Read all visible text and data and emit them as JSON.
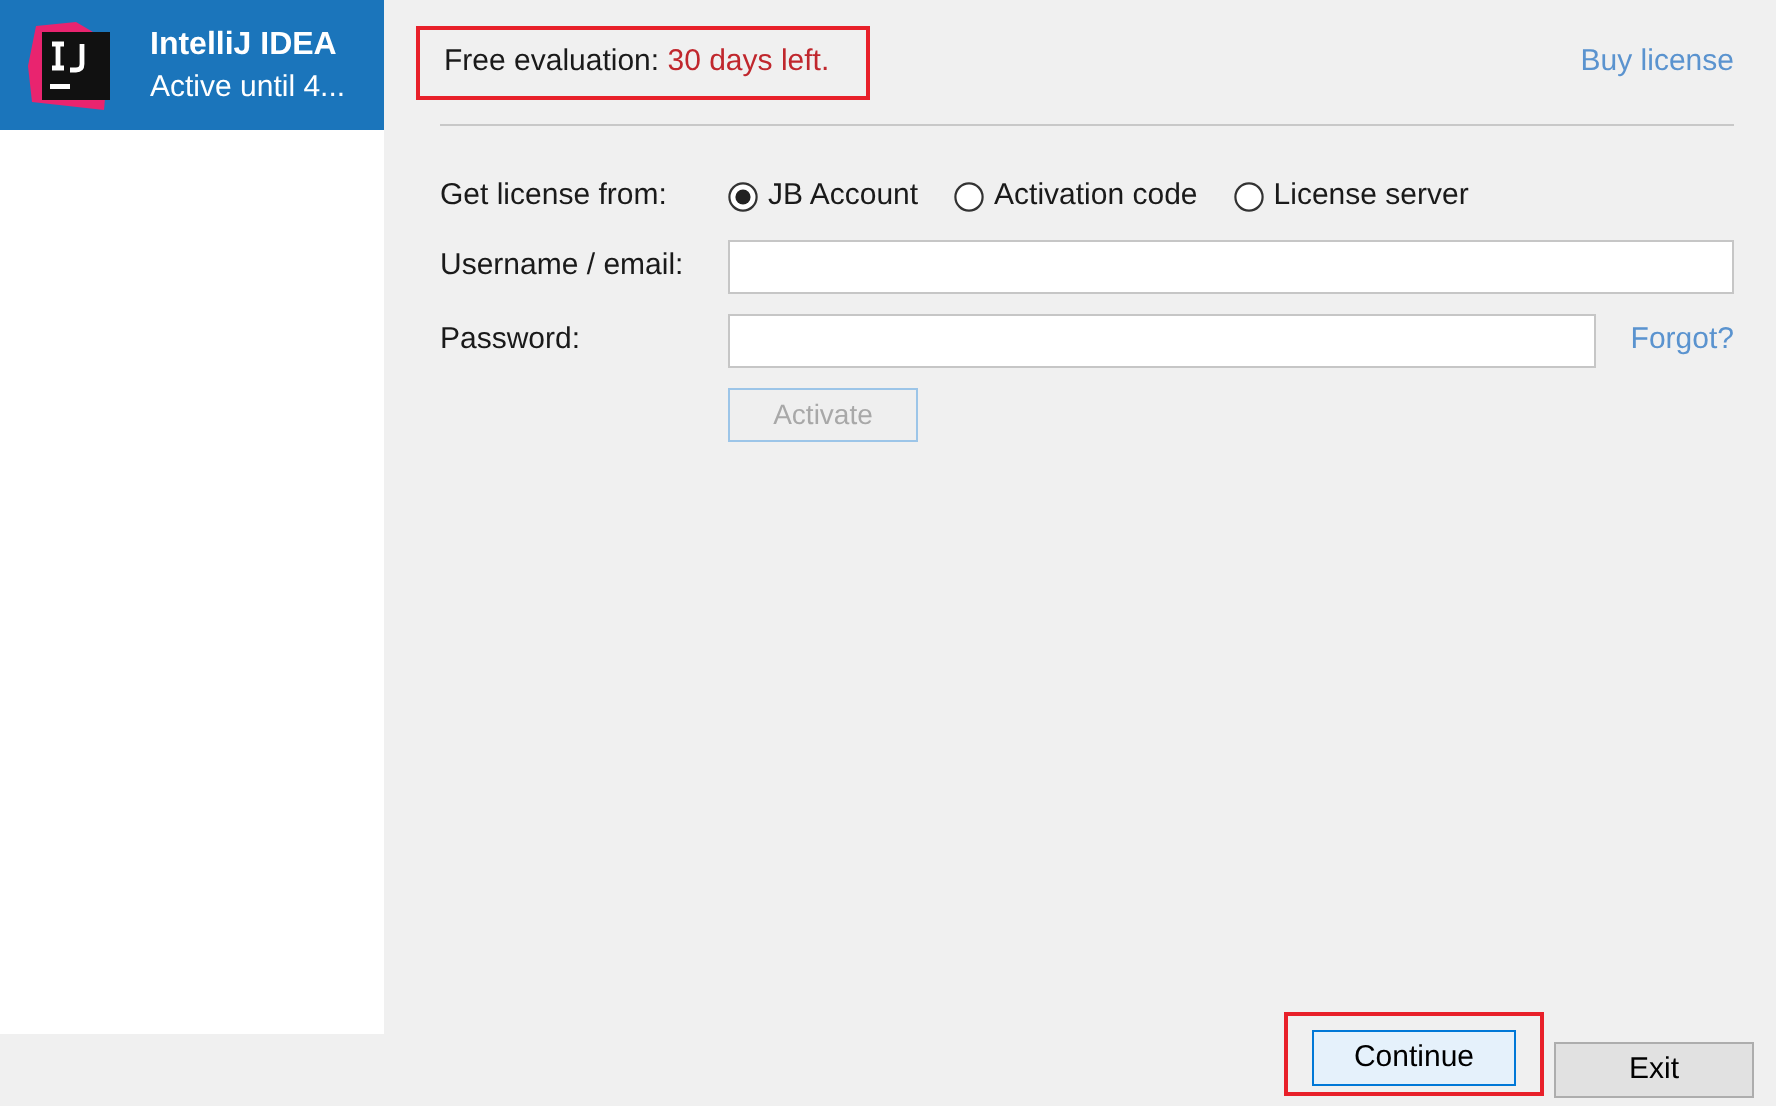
{
  "sidebar": {
    "items": [
      {
        "title": "IntelliJ IDEA",
        "subtitle": "Active until 4...",
        "selected": true
      }
    ]
  },
  "evaluation": {
    "label": "Free evaluation:",
    "remaining": "30 days left.",
    "highlighted": true
  },
  "buy_link": "Buy license",
  "license_source": {
    "label": "Get license from:",
    "options": [
      {
        "label": "JB Account",
        "selected": true
      },
      {
        "label": "Activation code",
        "selected": false
      },
      {
        "label": "License server",
        "selected": false
      }
    ]
  },
  "username": {
    "label": "Username / email:"
  },
  "password": {
    "label": "Password:",
    "link": "Forgot?"
  },
  "activate_button": {
    "label": "Activate",
    "disabled": true
  },
  "buttons": [
    {
      "label": "Continue",
      "default": true,
      "highlighted": true
    },
    {
      "label": "Exit",
      "default": false,
      "highlighted": false
    }
  ]
}
